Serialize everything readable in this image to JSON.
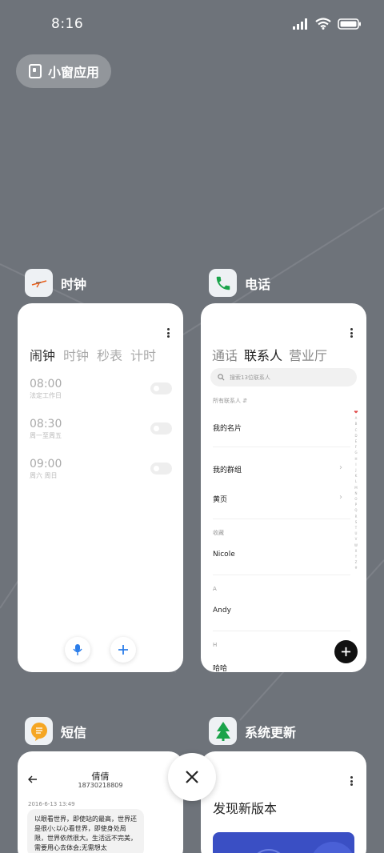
{
  "status_bar": {
    "time": "8:16"
  },
  "mini_window": {
    "label": "小窗应用"
  },
  "apps": {
    "clock": {
      "name": "时钟",
      "tabs": [
        "闹钟",
        "时钟",
        "秒表",
        "计时"
      ],
      "alarms": [
        {
          "time": "08:00",
          "repeat": "法定工作日"
        },
        {
          "time": "08:30",
          "repeat": "周一至周五"
        },
        {
          "time": "09:00",
          "repeat": "周六 周日"
        }
      ]
    },
    "phone": {
      "name": "电话",
      "tabs": [
        "通话",
        "联系人",
        "营业厅"
      ],
      "search_placeholder": "搜索13位联系人",
      "filter_label": "所有联系人",
      "my_card": "我的名片",
      "my_groups": "我的群组",
      "yellow_pages": "黄页",
      "favorites_header": "收藏",
      "favorite_contact": "Nicole",
      "section_a": "A",
      "contact_a": "Andy",
      "section_h": "H",
      "contact_h": "哈哈",
      "index_letters": [
        "A",
        "B",
        "C",
        "D",
        "E",
        "F",
        "G",
        "H",
        "I",
        "J",
        "K",
        "L",
        "M",
        "N",
        "O",
        "P",
        "Q",
        "R",
        "S",
        "T",
        "U",
        "V",
        "W",
        "X",
        "Y",
        "Z",
        "#"
      ]
    },
    "sms": {
      "name": "短信",
      "contact_name": "倩倩",
      "contact_number": "18730218809",
      "message_time": "2016-6-13 13:49",
      "message_text": "以眼看世界，即使站的最高，世界还是很小;以心看世界，即使身处局限，世界依然很大。生活远不完美，需要用心去体会;无需想太"
    },
    "update": {
      "name": "系统更新",
      "headline": "发现新版本"
    }
  },
  "colors": {
    "background": "#6e737a",
    "phone_green": "#1aa34a",
    "sms_orange": "#f5a623",
    "clock_orange": "#e8601c",
    "update_blue": "#3a4fc4",
    "fab_black": "#111111"
  }
}
